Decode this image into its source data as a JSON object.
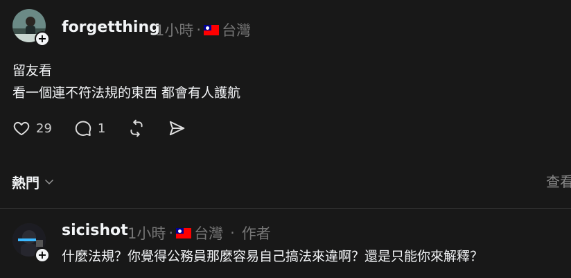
{
  "post": {
    "username": "forgetthing",
    "time": "1小時",
    "separator": "·",
    "location": "台灣",
    "lines": [
      "留友看",
      "看一個連不符法規的東西 都會有人護航"
    ],
    "like_count": "29",
    "comment_count": "1"
  },
  "sort": {
    "label": "熱門"
  },
  "view_activity": {
    "label": "查看"
  },
  "reply": {
    "username": "sicishot",
    "time": "1小時",
    "separator": "·",
    "location": "台灣",
    "separator2": "·",
    "author_tag": "作者",
    "text": "什麼法規？你覺得公務員那麼容易自己搞法來違啊？還是只能你來解釋？"
  },
  "icons": {
    "like": "heart-icon",
    "comment": "speech-bubble-icon",
    "repost": "repost-icon",
    "share": "send-icon",
    "sort": "chevron-down-icon",
    "follow": "plus-icon"
  },
  "colors": {
    "background": "#181818",
    "text": "#f3f5f7",
    "muted": "#777777",
    "divider": "#333333"
  }
}
